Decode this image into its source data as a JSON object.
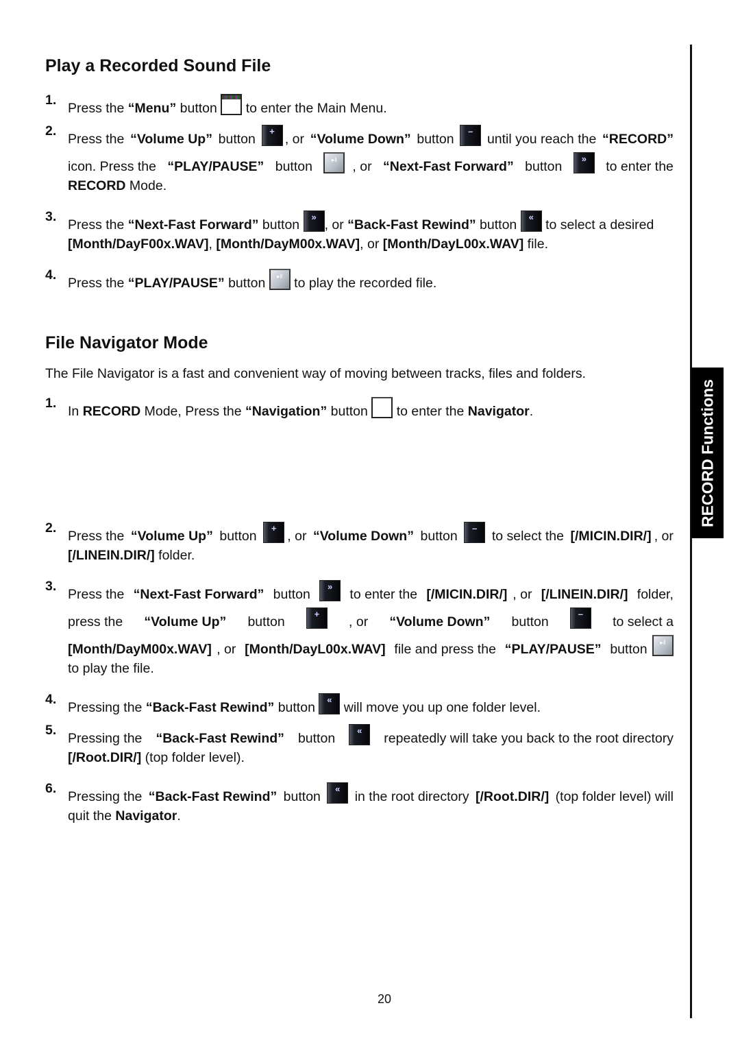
{
  "section1": {
    "title": "Play a Recorded Sound File",
    "steps": [
      {
        "n": "1.",
        "parts": [
          "Press the ",
          "“Menu”",
          " button ",
          " to enter the Main Menu."
        ]
      },
      {
        "n": "2.",
        "line1": [
          "Press the ",
          "“Volume Up”",
          " button ",
          ", or ",
          "“Volume Down”",
          " button ",
          " until you reach the ",
          "“RECORD”"
        ],
        "line2": [
          "icon. Press the ",
          "“PLAY/PAUSE”",
          " button ",
          ", or ",
          "“Next-Fast Forward”",
          " button ",
          " to enter the"
        ],
        "line3": [
          "RECORD",
          " Mode."
        ]
      },
      {
        "n": "3.",
        "line1": [
          "Press the ",
          "“Next-Fast Forward”",
          " button ",
          ", or ",
          "“Back-Fast Rewind”",
          " button ",
          " to select a desired"
        ],
        "line2": [
          "[Month/DayF00x.WAV]",
          ", ",
          "[Month/DayM00x.WAV]",
          ", or ",
          "[Month/DayL00x.WAV]",
          " file."
        ]
      },
      {
        "n": "4.",
        "parts": [
          "Press the ",
          "“PLAY/PAUSE”",
          " button ",
          " to play the recorded file."
        ]
      }
    ]
  },
  "section2": {
    "title": "File Navigator Mode",
    "intro": "The File Navigator is a fast and convenient way of moving between tracks, files and folders.",
    "steps": [
      {
        "n": "1.",
        "parts": [
          "In ",
          "RECORD",
          " Mode, Press the ",
          "“Navigation”",
          " button ",
          " to enter the ",
          "Navigator",
          "."
        ]
      },
      {
        "n": "2.",
        "line1": [
          "Press the ",
          "“Volume Up”",
          " button ",
          ", or ",
          "“Volume Down”",
          " button ",
          " to select the ",
          "[/MICIN.DIR/]",
          ", or"
        ],
        "line2": [
          "[/LINEIN.DIR/]",
          " folder."
        ]
      },
      {
        "n": "3.",
        "line1": [
          "Press the ",
          "“Next-Fast Forward”",
          " button ",
          " to enter the ",
          "[/MICIN.DIR/]",
          ", or ",
          "[/LINEIN.DIR/]",
          " folder,"
        ],
        "line2": [
          "press the ",
          "“Volume Up”",
          " button ",
          " , or ",
          "“Volume Down”",
          " button ",
          " to select a"
        ],
        "line3": [
          "[Month/DayM00x.WAV]",
          ", or ",
          "[Month/DayL00x.WAV]",
          " file and press the ",
          "“PLAY/PAUSE”",
          " button"
        ],
        "line4": [
          "to play the file."
        ]
      },
      {
        "n": "4.",
        "parts": [
          "Pressing the ",
          "“Back-Fast Rewind”",
          " button ",
          " will move you up one folder level."
        ]
      },
      {
        "n": "5.",
        "line1": [
          "Pressing the ",
          "“Back-Fast Rewind”",
          " button ",
          " repeatedly will take you back to the root directory"
        ],
        "line2": [
          "[/Root.DIR/]",
          " (top folder level)."
        ]
      },
      {
        "n": "6.",
        "line1": [
          "Pressing the ",
          "“Back-Fast Rewind”",
          " button ",
          " in the root directory ",
          "[/Root.DIR/]",
          " (top folder level) will"
        ],
        "line2": [
          "quit the ",
          "Navigator",
          "."
        ]
      }
    ]
  },
  "icons": {
    "volume_up": "+",
    "volume_down": "–",
    "next": "»",
    "back": "«",
    "play_pause": "▸‖"
  },
  "side_tab": {
    "label": "RECORD Functions"
  },
  "page_number": "20"
}
